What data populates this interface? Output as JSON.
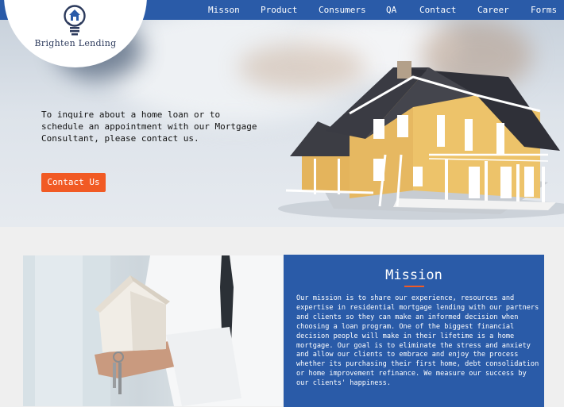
{
  "brand": {
    "name": "Brighten Lending"
  },
  "nav": {
    "items": [
      "Misson",
      "Product",
      "Consumers",
      "QA",
      "Contact",
      "Career",
      "Forms"
    ]
  },
  "hero": {
    "text": "To inquire about a home loan or to schedule an appointment with our Mortgage Consultant, please contact us.",
    "button_label": "Contact Us"
  },
  "mission": {
    "title": "Mission",
    "body": "Our mission is to share our experience, resources and expertise in residential mortgage lending with our partners and clients so they can make an informed decision when choosing a loan program. One of the biggest financial decision people will make in their lifetime is a home mortgage. Our goal is to eliminate the stress and anxiety and allow our clients to embrace and enjoy the process whether its purchasing their first home, debt consolidation or home improvement refinance. We measure our success by our clients' happiness."
  },
  "colors": {
    "primary": "#2a5ba8",
    "accent": "#f15a24",
    "brand_text": "#2c3a5c"
  }
}
